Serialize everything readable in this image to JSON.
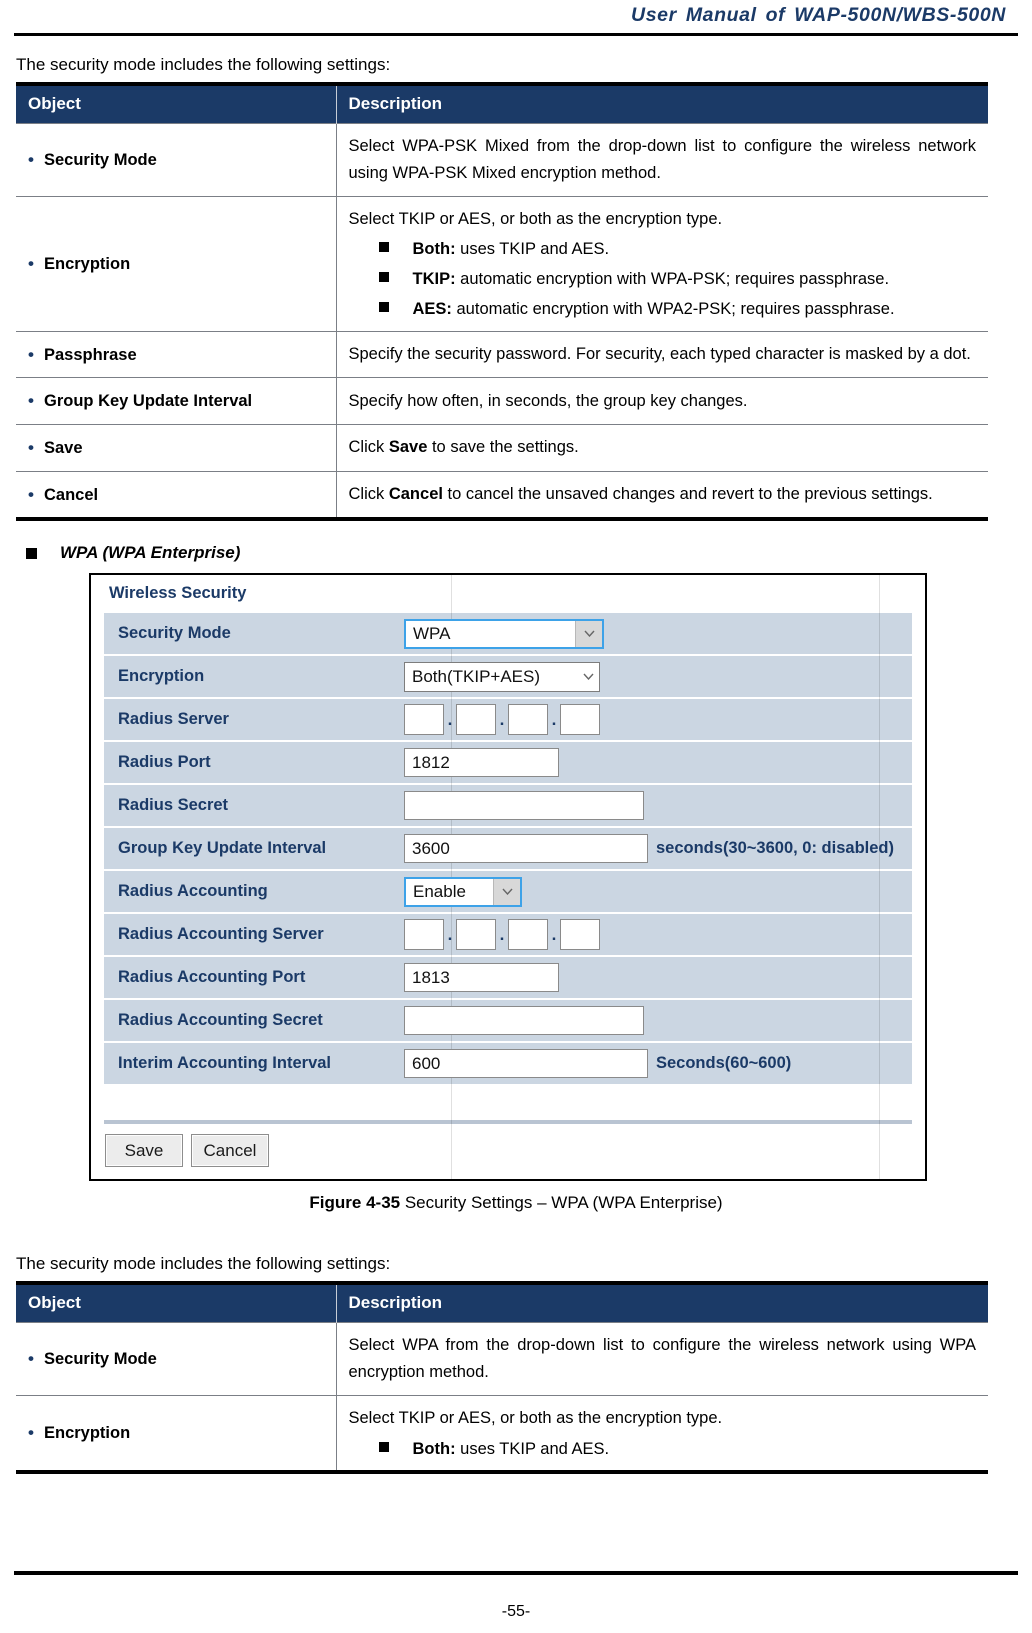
{
  "header": {
    "running_title": "User Manual of WAP-500N/WBS-500N"
  },
  "intro_text_1": "The security mode includes the following settings:",
  "intro_text_2": "The security mode includes the following settings:",
  "table1": {
    "columns": [
      "Object",
      "Description"
    ],
    "rows": [
      {
        "object": "Security Mode",
        "description": "Select WPA-PSK Mixed from the drop-down list to configure the wireless network using WPA-PSK Mixed encryption method.",
        "sub": []
      },
      {
        "object": "Encryption",
        "description": "Select TKIP or AES, or both as the encryption type.",
        "sub": [
          {
            "term": "Both:",
            "text": " uses TKIP and AES."
          },
          {
            "term": "TKIP:",
            "text": " automatic encryption with WPA-PSK; requires passphrase."
          },
          {
            "term": "AES:",
            "text": " automatic encryption with WPA2-PSK; requires passphrase."
          }
        ]
      },
      {
        "object": "Passphrase",
        "description": "Specify the security password. For security, each typed character is masked by a dot.",
        "sub": []
      },
      {
        "object": "Group Key Update Interval",
        "description": "Specify how often, in seconds, the group key changes.",
        "sub": []
      },
      {
        "object": "Save",
        "description_pre": "Click ",
        "description_bold": "Save",
        "description_post": " to save the settings.",
        "sub": []
      },
      {
        "object": "Cancel",
        "description_pre": "Click ",
        "description_bold": "Cancel",
        "description_post": " to cancel the unsaved changes and revert to the previous settings.",
        "sub": []
      }
    ]
  },
  "section_heading": "WPA (WPA Enterprise)",
  "screenshot": {
    "title": "Wireless Security",
    "rows": [
      {
        "label": "Security Mode",
        "control": "select",
        "value": "WPA",
        "hint": "",
        "focused": true
      },
      {
        "label": "Encryption",
        "control": "select",
        "value": "Both(TKIP+AES)",
        "hint": "",
        "focused": false
      },
      {
        "label": "Radius Server",
        "control": "ip",
        "value": "",
        "hint": "",
        "focused": false
      },
      {
        "label": "Radius Port",
        "control": "text-port",
        "value": "1812",
        "hint": "",
        "focused": false
      },
      {
        "label": "Radius Secret",
        "control": "text-secret",
        "value": "",
        "hint": "",
        "focused": false
      },
      {
        "label": "Group Key Update Interval",
        "control": "text-gkui",
        "value": "3600",
        "hint": "seconds(30~3600, 0: disabled)",
        "focused": false
      },
      {
        "label": "Radius Accounting",
        "control": "select-acct",
        "value": "Enable",
        "hint": "",
        "focused": true
      },
      {
        "label": "Radius Accounting Server",
        "control": "ip",
        "value": "",
        "hint": "",
        "focused": false
      },
      {
        "label": "Radius Accounting Port",
        "control": "text-port",
        "value": "1813",
        "hint": "",
        "focused": false
      },
      {
        "label": "Radius Accounting Secret",
        "control": "text-secret",
        "value": "",
        "hint": "",
        "focused": false
      },
      {
        "label": "Interim Accounting Interval",
        "control": "text-interim",
        "value": "600",
        "hint": "Seconds(60~600)",
        "focused": false
      }
    ],
    "buttons": {
      "save": "Save",
      "cancel": "Cancel"
    }
  },
  "figure": {
    "number": "Figure 4-35",
    "caption": " Security Settings – WPA (WPA Enterprise)"
  },
  "table2": {
    "columns": [
      "Object",
      "Description"
    ],
    "rows": [
      {
        "object": "Security Mode",
        "description": "Select WPA from the drop-down list to configure the wireless network using WPA encryption method.",
        "sub": []
      },
      {
        "object": "Encryption",
        "description": "Select TKIP or AES, or both as the encryption type.",
        "sub": [
          {
            "term": "Both:",
            "text": " uses TKIP and AES."
          }
        ]
      }
    ]
  },
  "footer": {
    "page_number": "-55-"
  },
  "colors": {
    "brand_navy": "#1b3a67",
    "row_blue": "#cbd6e2",
    "focus_blue": "#3da2e8"
  }
}
